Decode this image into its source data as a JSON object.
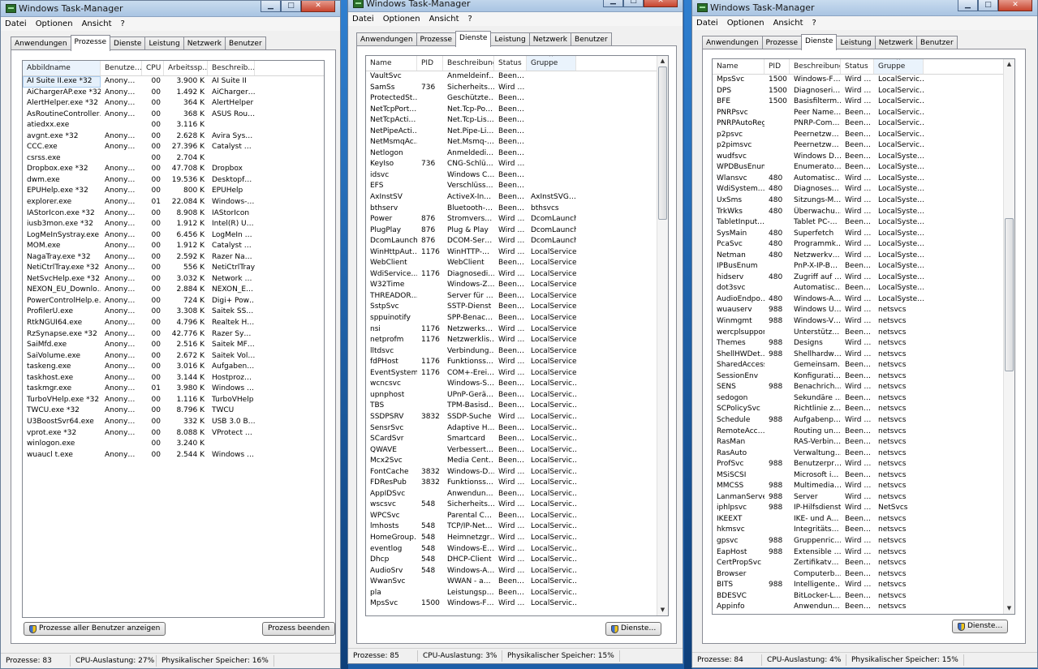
{
  "windows": [
    {
      "title": "Windows Task-Manager",
      "menu": [
        "Datei",
        "Optionen",
        "Ansicht",
        "?"
      ],
      "tabs": [
        "Anwendungen",
        "Prozesse",
        "Dienste",
        "Leistung",
        "Netzwerk",
        "Benutzer"
      ],
      "active_tab": 1,
      "columns": [
        "Abbildname",
        "Benutze…",
        "CPU",
        "Arbeitssp…",
        "Beschreib…"
      ],
      "sorted_column": 0,
      "rows": [
        [
          "AI Suite II.exe *32",
          "Anony…",
          "00",
          "3.900 K",
          "AI Suite II"
        ],
        [
          "AiChargerAP.exe *32",
          "Anony…",
          "00",
          "1.492 K",
          "AiCharger…"
        ],
        [
          "AlertHelper.exe *32",
          "Anony…",
          "00",
          "364 K",
          "AlertHelper"
        ],
        [
          "AsRoutineController…",
          "Anony…",
          "00",
          "368 K",
          "ASUS Rou…"
        ],
        [
          "atiedxx.exe",
          "",
          "00",
          "3.116 K",
          ""
        ],
        [
          "avgnt.exe *32",
          "Anony…",
          "00",
          "2.628 K",
          "Avira Sys…"
        ],
        [
          "CCC.exe",
          "Anony…",
          "00",
          "27.396 K",
          "Catalyst …"
        ],
        [
          "csrss.exe",
          "",
          "00",
          "2.704 K",
          ""
        ],
        [
          "Dropbox.exe *32",
          "Anony…",
          "00",
          "47.708 K",
          "Dropbox"
        ],
        [
          "dwm.exe",
          "Anony…",
          "00",
          "19.536 K",
          "Desktopf…"
        ],
        [
          "EPUHelp.exe *32",
          "Anony…",
          "00",
          "800 K",
          "EPUHelp"
        ],
        [
          "explorer.exe",
          "Anony…",
          "01",
          "22.084 K",
          "Windows-…"
        ],
        [
          "IAStorIcon.exe *32",
          "Anony…",
          "00",
          "8.908 K",
          "IAStorIcon"
        ],
        [
          "iusb3mon.exe *32",
          "Anony…",
          "00",
          "1.912 K",
          "Intel(R) U…"
        ],
        [
          "LogMeInSystray.exe",
          "Anony…",
          "00",
          "6.456 K",
          "LogMeIn …"
        ],
        [
          "MOM.exe",
          "Anony…",
          "00",
          "1.912 K",
          "Catalyst …"
        ],
        [
          "NagaTray.exe *32",
          "Anony…",
          "00",
          "2.592 K",
          "Razer Na…"
        ],
        [
          "NetiCtrlTray.exe *32",
          "Anony…",
          "00",
          "556 K",
          "NetiCtrlTray"
        ],
        [
          "NetSvcHelp.exe *32",
          "Anony…",
          "00",
          "3.032 K",
          "Network …"
        ],
        [
          "NEXON_EU_Downlo…",
          "Anony…",
          "00",
          "2.884 K",
          "NEXON_E…"
        ],
        [
          "PowerControlHelp.e…",
          "Anony…",
          "00",
          "724 K",
          "Digi+ Pow…"
        ],
        [
          "ProfilerU.exe",
          "Anony…",
          "00",
          "3.308 K",
          "Saitek SS…"
        ],
        [
          "RtkNGUI64.exe",
          "Anony…",
          "00",
          "4.796 K",
          "Realtek H…"
        ],
        [
          "RzSynapse.exe *32",
          "Anony…",
          "00",
          "42.776 K",
          "Razer Sy…"
        ],
        [
          "SaiMfd.exe",
          "Anony…",
          "00",
          "2.516 K",
          "Saitek MF…"
        ],
        [
          "SaiVolume.exe",
          "Anony…",
          "00",
          "2.672 K",
          "Saitek Vol…"
        ],
        [
          "taskeng.exe",
          "Anony…",
          "00",
          "3.016 K",
          "Aufgaben…"
        ],
        [
          "taskhost.exe",
          "Anony…",
          "00",
          "3.144 K",
          "Hostproz…"
        ],
        [
          "taskmgr.exe",
          "Anony…",
          "01",
          "3.980 K",
          "Windows …"
        ],
        [
          "TurboVHelp.exe *32",
          "Anony…",
          "00",
          "1.116 K",
          "TurboVHelp"
        ],
        [
          "TWCU.exe *32",
          "Anony…",
          "00",
          "8.796 K",
          "TWCU"
        ],
        [
          "U3BoostSvr64.exe",
          "Anony…",
          "00",
          "332 K",
          "USB 3.0 B…"
        ],
        [
          "vprot.exe *32",
          "Anony…",
          "00",
          "8.088 K",
          "VProtect …"
        ],
        [
          "winlogon.exe",
          "",
          "00",
          "3.240 K",
          ""
        ],
        [
          "wuaucl t.exe",
          "Anony…",
          "00",
          "2.544 K",
          "Windows …"
        ]
      ],
      "buttons": [
        "Prozesse aller Benutzer anzeigen",
        "Prozess beenden"
      ],
      "status": [
        "Prozesse: 83",
        "CPU-Auslastung: 27%",
        "Physikalischer Speicher: 16%"
      ]
    },
    {
      "title": "Windows Task-Manager",
      "menu": [
        "Datei",
        "Optionen",
        "Ansicht",
        "?"
      ],
      "tabs": [
        "Anwendungen",
        "Prozesse",
        "Dienste",
        "Leistung",
        "Netzwerk",
        "Benutzer"
      ],
      "active_tab": 2,
      "columns": [
        "Name",
        "PID",
        "Beschreibung",
        "Status",
        "Gruppe"
      ],
      "sorted_column": 4,
      "rows": [
        [
          "VaultSvc",
          "",
          "Anmeldeinf…",
          "Been…",
          ""
        ],
        [
          "SamSs",
          "736",
          "Sicherheits…",
          "Wird …",
          ""
        ],
        [
          "ProtectedSt…",
          "",
          "Geschützte…",
          "Been…",
          ""
        ],
        [
          "NetTcpPort…",
          "",
          "Net.Tcp-Po…",
          "Been…",
          ""
        ],
        [
          "NetTcpActi…",
          "",
          "Net.Tcp-Lis…",
          "Been…",
          ""
        ],
        [
          "NetPipeActi…",
          "",
          "Net.Pipe-Li…",
          "Been…",
          ""
        ],
        [
          "NetMsmqAc…",
          "",
          "Net.Msmq-…",
          "Been…",
          ""
        ],
        [
          "Netlogon",
          "",
          "Anmeldedi…",
          "Been…",
          ""
        ],
        [
          "KeyIso",
          "736",
          "CNG-Schlü…",
          "Wird …",
          ""
        ],
        [
          "idsvc",
          "",
          "Windows C…",
          "Been…",
          ""
        ],
        [
          "EFS",
          "",
          "Verschlüss…",
          "Been…",
          ""
        ],
        [
          "AxInstSV",
          "",
          "ActiveX-In…",
          "Been…",
          "AxInstSVG…"
        ],
        [
          "bthserv",
          "",
          "Bluetooth-…",
          "Been…",
          "bthsvcs"
        ],
        [
          "Power",
          "876",
          "Stromvers…",
          "Wird …",
          "DcomLaunch"
        ],
        [
          "PlugPlay",
          "876",
          "Plug & Play",
          "Wird …",
          "DcomLaunch"
        ],
        [
          "DcomLaunch",
          "876",
          "DCOM-Ser…",
          "Wird …",
          "DcomLaunch"
        ],
        [
          "WinHttpAut…",
          "1176",
          "WinHTTP-…",
          "Wird …",
          "LocalService"
        ],
        [
          "WebClient",
          "",
          "WebClient",
          "Been…",
          "LocalService"
        ],
        [
          "WdiService…",
          "1176",
          "Diagnosedi…",
          "Wird …",
          "LocalService"
        ],
        [
          "W32Time",
          "",
          "Windows-Z…",
          "Been…",
          "LocalService"
        ],
        [
          "THREADOR…",
          "",
          "Server für …",
          "Been…",
          "LocalService"
        ],
        [
          "SstpSvc",
          "",
          "SSTP-Dienst",
          "Been…",
          "LocalService"
        ],
        [
          "sppuinotify",
          "",
          "SPP-Benac…",
          "Been…",
          "LocalService"
        ],
        [
          "nsi",
          "1176",
          "Netzwerks…",
          "Wird …",
          "LocalService"
        ],
        [
          "netprofm",
          "1176",
          "Netzwerklis…",
          "Wird …",
          "LocalService"
        ],
        [
          "lltdsvc",
          "",
          "Verbindung…",
          "Been…",
          "LocalService"
        ],
        [
          "fdPHost",
          "1176",
          "Funktionss…",
          "Wird …",
          "LocalService"
        ],
        [
          "EventSystem",
          "1176",
          "COM+-Erei…",
          "Wird …",
          "LocalService"
        ],
        [
          "wcncsvc",
          "",
          "Windows-S…",
          "Been…",
          "LocalServic…"
        ],
        [
          "upnphost",
          "",
          "UPnP-Gerä…",
          "Been…",
          "LocalServic…"
        ],
        [
          "TBS",
          "",
          "TPM-Basisd…",
          "Been…",
          "LocalServic…"
        ],
        [
          "SSDPSRV",
          "3832",
          "SSDP-Suche",
          "Wird …",
          "LocalServic…"
        ],
        [
          "SensrSvc",
          "",
          "Adaptive H…",
          "Been…",
          "LocalServic…"
        ],
        [
          "SCardSvr",
          "",
          "Smartcard",
          "Been…",
          "LocalServic…"
        ],
        [
          "QWAVE",
          "",
          "Verbessert…",
          "Been…",
          "LocalServic…"
        ],
        [
          "Mcx2Svc",
          "",
          "Media Cent…",
          "Been…",
          "LocalServic…"
        ],
        [
          "FontCache",
          "3832",
          "Windows-D…",
          "Wird …",
          "LocalServic…"
        ],
        [
          "FDResPub",
          "3832",
          "Funktionss…",
          "Wird …",
          "LocalServic…"
        ],
        [
          "AppIDSvc",
          "",
          "Anwendun…",
          "Been…",
          "LocalServic…"
        ],
        [
          "wscsvc",
          "548",
          "Sicherheits…",
          "Wird …",
          "LocalServic…"
        ],
        [
          "WPCSvc",
          "",
          "Parental C…",
          "Been…",
          "LocalServic…"
        ],
        [
          "lmhosts",
          "548",
          "TCP/IP-Net…",
          "Wird …",
          "LocalServic…"
        ],
        [
          "HomeGroup…",
          "548",
          "Heimnetzgr…",
          "Wird …",
          "LocalServic…"
        ],
        [
          "eventlog",
          "548",
          "Windows-E…",
          "Wird …",
          "LocalServic…"
        ],
        [
          "Dhcp",
          "548",
          "DHCP-Client",
          "Wird …",
          "LocalServic…"
        ],
        [
          "AudioSrv",
          "548",
          "Windows-A…",
          "Wird …",
          "LocalServic…"
        ],
        [
          "WwanSvc",
          "",
          "WWAN - a…",
          "Been…",
          "LocalServic…"
        ],
        [
          "pla",
          "",
          "Leistungsp…",
          "Been…",
          "LocalServic…"
        ],
        [
          "MpsSvc",
          "1500",
          "Windows-F…",
          "Wird …",
          "LocalServic…"
        ]
      ],
      "buttons": [
        "Dienste…"
      ],
      "status": [
        "Prozesse: 85",
        "CPU-Auslastung: 3%",
        "Physikalischer Speicher: 15%"
      ]
    },
    {
      "title": "Windows Task-Manager",
      "menu": [
        "Datei",
        "Optionen",
        "Ansicht",
        "?"
      ],
      "tabs": [
        "Anwendungen",
        "Prozesse",
        "Dienste",
        "Leistung",
        "Netzwerk",
        "Benutzer"
      ],
      "active_tab": 2,
      "columns": [
        "Name",
        "PID",
        "Beschreibung",
        "Status",
        "Gruppe"
      ],
      "sorted_column": 4,
      "rows": [
        [
          "MpsSvc",
          "1500",
          "Windows-F…",
          "Wird …",
          "LocalServic…"
        ],
        [
          "DPS",
          "1500",
          "Diagnoseri…",
          "Wird …",
          "LocalServic…"
        ],
        [
          "BFE",
          "1500",
          "Basisfilterm…",
          "Wird …",
          "LocalServic…"
        ],
        [
          "PNRPsvc",
          "",
          "Peer Name…",
          "Been…",
          "LocalServic…"
        ],
        [
          "PNRPAutoReg",
          "",
          "PNRP-Com…",
          "Been…",
          "LocalServic…"
        ],
        [
          "p2psvc",
          "",
          "Peernetzw…",
          "Been…",
          "LocalServic…"
        ],
        [
          "p2pimsvc",
          "",
          "Peernetzw…",
          "Been…",
          "LocalServic…"
        ],
        [
          "wudfsvc",
          "",
          "Windows D…",
          "Been…",
          "LocalSyste…"
        ],
        [
          "WPDBusEnum",
          "",
          "Enumerato…",
          "Been…",
          "LocalSyste…"
        ],
        [
          "Wlansvc",
          "480",
          "Automatisc…",
          "Wird …",
          "LocalSyste…"
        ],
        [
          "WdiSystem…",
          "480",
          "Diagnoses…",
          "Wird …",
          "LocalSyste…"
        ],
        [
          "UxSms",
          "480",
          "Sitzungs-M…",
          "Wird …",
          "LocalSyste…"
        ],
        [
          "TrkWks",
          "480",
          "Überwachu…",
          "Wird …",
          "LocalSyste…"
        ],
        [
          "TabletInput…",
          "",
          "Tablet PC-…",
          "Been…",
          "LocalSyste…"
        ],
        [
          "SysMain",
          "480",
          "Superfetch",
          "Wird …",
          "LocalSyste…"
        ],
        [
          "PcaSvc",
          "480",
          "Programmk…",
          "Wird …",
          "LocalSyste…"
        ],
        [
          "Netman",
          "480",
          "Netzwerkv…",
          "Wird …",
          "LocalSyste…"
        ],
        [
          "IPBusEnum",
          "",
          "PnP-X-IP-B…",
          "Been…",
          "LocalSyste…"
        ],
        [
          "hidserv",
          "480",
          "Zugriff auf …",
          "Wird …",
          "LocalSyste…"
        ],
        [
          "dot3svc",
          "",
          "Automatisc…",
          "Been…",
          "LocalSyste…"
        ],
        [
          "AudioEndpo…",
          "480",
          "Windows-A…",
          "Wird …",
          "LocalSyste…"
        ],
        [
          "wuauserv",
          "988",
          "Windows U…",
          "Wird …",
          "netsvcs"
        ],
        [
          "Winmgmt",
          "988",
          "Windows-V…",
          "Wird …",
          "netsvcs"
        ],
        [
          "wercplsupport",
          "",
          "Unterstütz…",
          "Been…",
          "netsvcs"
        ],
        [
          "Themes",
          "988",
          "Designs",
          "Wird …",
          "netsvcs"
        ],
        [
          "ShellHWDet…",
          "988",
          "Shellhardw…",
          "Wird …",
          "netsvcs"
        ],
        [
          "SharedAccess",
          "",
          "Gemeinsam…",
          "Been…",
          "netsvcs"
        ],
        [
          "SessionEnv",
          "",
          "Konfigurati…",
          "Been…",
          "netsvcs"
        ],
        [
          "SENS",
          "988",
          "Benachrich…",
          "Wird …",
          "netsvcs"
        ],
        [
          "sedogon",
          "",
          "Sekundäre …",
          "Been…",
          "netsvcs"
        ],
        [
          "SCPolicySvc",
          "",
          "Richtlinie z…",
          "Been…",
          "netsvcs"
        ],
        [
          "Schedule",
          "988",
          "Aufgabenp…",
          "Wird …",
          "netsvcs"
        ],
        [
          "RemoteAcc…",
          "",
          "Routing un…",
          "Been…",
          "netsvcs"
        ],
        [
          "RasMan",
          "",
          "RAS-Verbin…",
          "Been…",
          "netsvcs"
        ],
        [
          "RasAuto",
          "",
          "Verwaltung…",
          "Been…",
          "netsvcs"
        ],
        [
          "ProfSvc",
          "988",
          "Benutzerpr…",
          "Wird …",
          "netsvcs"
        ],
        [
          "MSiSCSI",
          "",
          "Microsoft i…",
          "Been…",
          "netsvcs"
        ],
        [
          "MMCSS",
          "988",
          "Multimedia…",
          "Wird …",
          "netsvcs"
        ],
        [
          "LanmanServer",
          "988",
          "Server",
          "Wird …",
          "netsvcs"
        ],
        [
          "iphlpsvc",
          "988",
          "IP-Hilfsdienst",
          "Wird …",
          "NetSvcs"
        ],
        [
          "IKEEXT",
          "",
          "IKE- und A…",
          "Been…",
          "netsvcs"
        ],
        [
          "hkmsvc",
          "",
          "Integritäts…",
          "Been…",
          "netsvcs"
        ],
        [
          "gpsvc",
          "988",
          "Gruppenric…",
          "Wird …",
          "netsvcs"
        ],
        [
          "EapHost",
          "988",
          "Extensible …",
          "Wird …",
          "netsvcs"
        ],
        [
          "CertPropSvc",
          "",
          "Zertifikatv…",
          "Been…",
          "netsvcs"
        ],
        [
          "Browser",
          "",
          "Computerb…",
          "Been…",
          "netsvcs"
        ],
        [
          "BITS",
          "988",
          "Intelligente…",
          "Wird …",
          "netsvcs"
        ],
        [
          "BDESVC",
          "",
          "BitLocker-L…",
          "Been…",
          "netsvcs"
        ],
        [
          "Appinfo",
          "",
          "Anwendun…",
          "Been…",
          "netsvcs"
        ]
      ],
      "buttons": [
        "Dienste…"
      ],
      "status": [
        "Prozesse: 84",
        "CPU-Auslastung: 4%",
        "Physikalischer Speicher: 15%"
      ]
    }
  ]
}
